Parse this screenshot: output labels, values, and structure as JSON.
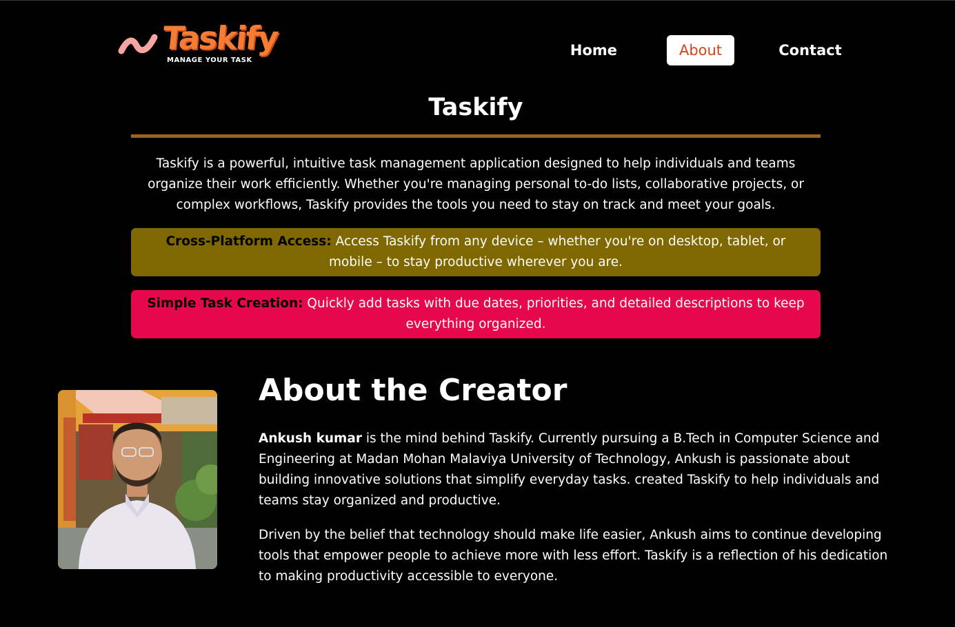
{
  "header": {
    "logo": {
      "name": "Taskify",
      "tagline": "MANAGE YOUR TASK",
      "color": "#f47c35"
    },
    "nav": [
      {
        "label": "Home",
        "active": false
      },
      {
        "label": "About",
        "active": true
      },
      {
        "label": "Contact",
        "active": false
      }
    ]
  },
  "intro": {
    "title": "Taskify",
    "description": "Taskify is a powerful, intuitive task management application designed to help individuals and teams organize their work efficiently. Whether you're managing personal to-do lists, collaborative projects, or complex workflows, Taskify provides the tools you need to stay on track and meet your goals.",
    "features": [
      {
        "title": "Cross-Platform Access:",
        "text": " Access Taskify from any device – whether you're on desktop, tablet, or mobile – to stay productive wherever you are.",
        "color": "#806800"
      },
      {
        "title": "Simple Task Creation:",
        "text": " Quickly add tasks with due dates, priorities, and detailed descriptions to keep everything organized.",
        "color": "#e5084a"
      }
    ]
  },
  "creator": {
    "heading": "About the Creator",
    "name": "Ankush kumar",
    "paragraph1": " is the mind behind Taskify. Currently pursuing a B.Tech in Computer Science and Engineering at Madan Mohan Malaviya University of Technology, Ankush is passionate about building innovative solutions that simplify everyday tasks. created Taskify to help individuals and teams stay organized and productive.",
    "paragraph2": "Driven by the belief that technology should make life easier, Ankush aims to continue developing tools that empower people to achieve more with less effort. Taskify is a reflection of his dedication to making productivity accessible to everyone."
  }
}
